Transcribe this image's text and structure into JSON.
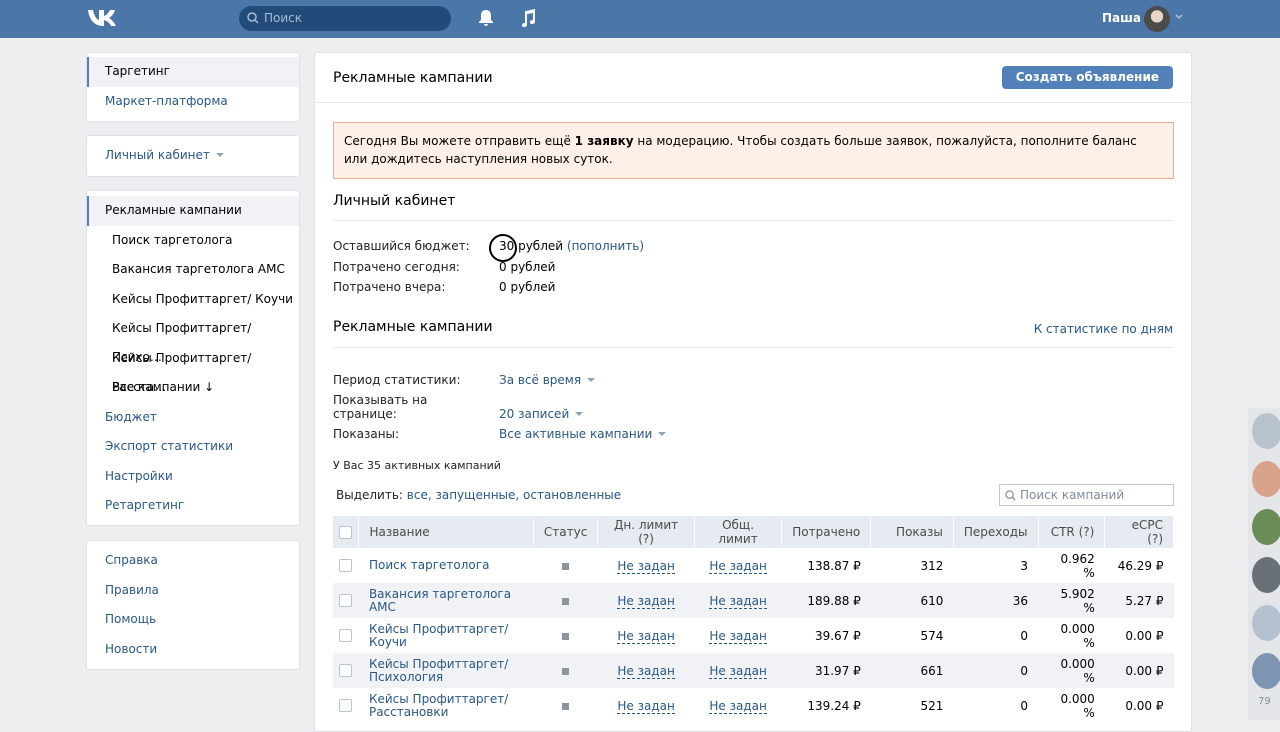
{
  "header": {
    "search_placeholder": "Поиск",
    "user_name": "Паша"
  },
  "left_menu": {
    "group1": [
      "Таргетинг",
      "Маркет-платформа"
    ],
    "cabinet": "Личный кабинет",
    "group3": [
      "Рекламные кампании",
      "Поиск таргетолога",
      "Вакансия таргетолога АМС",
      "Кейсы Профиттаргет/ Коучи",
      "Кейсы Профиттаргет/ Психо…",
      "Кейсы Профиттаргет/ Расста…",
      "Все кампании ↓",
      "Бюджет",
      "Экспорт статистики",
      "Настройки",
      "Ретаргетинг"
    ],
    "group4": [
      "Справка",
      "Правила",
      "Помощь",
      "Новости"
    ]
  },
  "main": {
    "title": "Рекламные кампании",
    "create_button": "Создать объявление",
    "warning_pre": "Сегодня Вы можете отправить ещё ",
    "warning_bold": "1 заявку",
    "warning_post": " на модерацию. Чтобы создать больше заявок, пожалуйста, пополните баланс или дождитесь наступления новых суток.",
    "cabinet_title": "Личный кабинет",
    "budget_label": "Оставшийся бюджет:",
    "budget_value": "30 рублей",
    "budget_link": "(пополнить)",
    "spent_today_label": "Потрачено сегодня:",
    "spent_today_value": "0 рублей",
    "spent_yesterday_label": "Потрачено вчера:",
    "spent_yesterday_value": "0 рублей",
    "campaigns_title": "Рекламные кампании",
    "stats_link": "К статистике по дням",
    "period_label": "Период статистики:",
    "period_value": "За всё время",
    "per_page_label": "Показывать на странице:",
    "per_page_value": "20 записей",
    "shown_label": "Показаны:",
    "shown_value": "Все активные кампании",
    "active_count": "У Вас 35 активных кампаний",
    "select_label": "Выделить:",
    "select_links": "все, запущенные, остановленные",
    "search_placeholder": "Поиск кампаний"
  },
  "table": {
    "headers": [
      "Название",
      "Статус",
      "Дн. лимит (?)",
      "Общ. лимит",
      "Потрачено",
      "Показы",
      "Переходы",
      "CTR (?)",
      "eCPC (?)"
    ],
    "rows": [
      {
        "name": "Поиск таргетолога",
        "day": "Не задан",
        "total": "Не задан",
        "spent": "138.87 ₽",
        "views": "312",
        "clicks": "3",
        "ctr": "0.962 %",
        "ecpc": "46.29 ₽"
      },
      {
        "name": "Вакансия таргетолога АМС",
        "day": "Не задан",
        "total": "Не задан",
        "spent": "189.88 ₽",
        "views": "610",
        "clicks": "36",
        "ctr": "5.902 %",
        "ecpc": "5.27 ₽"
      },
      {
        "name": "Кейсы Профиттаргет/ Коучи",
        "day": "Не задан",
        "total": "Не задан",
        "spent": "39.67 ₽",
        "views": "574",
        "clicks": "0",
        "ctr": "0.000 %",
        "ecpc": "0.00 ₽"
      },
      {
        "name": "Кейсы Профиттаргет/ Психология",
        "day": "Не задан",
        "total": "Не задан",
        "spent": "31.97 ₽",
        "views": "661",
        "clicks": "0",
        "ctr": "0.000 %",
        "ecpc": "0.00 ₽"
      },
      {
        "name": "Кейсы Профиттаргет/ Расстановки",
        "day": "Не задан",
        "total": "Не задан",
        "spent": "139.24 ₽",
        "views": "521",
        "clicks": "0",
        "ctr": "0.000 %",
        "ecpc": "0.00 ₽"
      }
    ]
  },
  "right_strip_count": "79"
}
